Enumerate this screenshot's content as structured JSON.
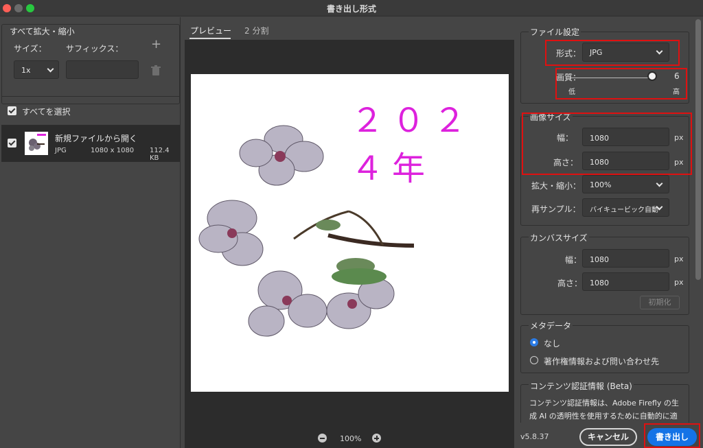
{
  "window": {
    "title": "書き出し形式"
  },
  "left": {
    "scale_section": {
      "title": "すべて拡大・縮小",
      "size_label": "サイズ：",
      "suffix_label": "サフィックス：",
      "size_value": "1x",
      "suffix_value": ""
    },
    "select_all_label": "すべてを選択",
    "file": {
      "name": "新規ファイルから開く",
      "format": "JPG",
      "dimensions": "1080 x 1080",
      "size": "112.4 KB",
      "checked": true
    }
  },
  "center": {
    "tabs": [
      {
        "label": "プレビュー",
        "active": true
      },
      {
        "label": "2 分割",
        "active": false
      }
    ],
    "preview_text": "２０２４年",
    "zoom": "100%"
  },
  "right": {
    "file_settings": {
      "title": "ファイル設定",
      "format_label": "形式：",
      "format_value": "JPG",
      "quality_label": "画質：",
      "quality_value": "6",
      "quality_low": "低",
      "quality_high": "高"
    },
    "image_size": {
      "title": "画像サイズ",
      "width_label": "幅：",
      "width_value": "1080",
      "height_label": "高さ：",
      "height_value": "1080",
      "unit": "px",
      "scale_label": "拡大・縮小：",
      "scale_value": "100%",
      "resample_label": "再サンプル：",
      "resample_value": "バイキュービック自動"
    },
    "canvas_size": {
      "title": "カンバスサイズ",
      "width_label": "幅：",
      "width_value": "1080",
      "height_label": "高さ：",
      "height_value": "1080",
      "unit": "px",
      "reset_label": "初期化"
    },
    "metadata": {
      "title": "メタデータ",
      "option_none": "なし",
      "option_copyright": "著作権情報および問い合わせ先",
      "selected": "なし"
    },
    "content_credentials": {
      "title": "コンテンツ認証情報 (Beta)",
      "text": "コンテンツ認証情報は、Adobe Firefly の生成 AI の透明性を使用するために自動的に適用されます"
    }
  },
  "footer": {
    "version": "v5.8.37",
    "cancel_label": "キャンセル",
    "export_label": "書き出し"
  },
  "colors": {
    "accent": "#1473e6",
    "highlight_box": "#e01010",
    "preview_text": "#dd22dd"
  }
}
